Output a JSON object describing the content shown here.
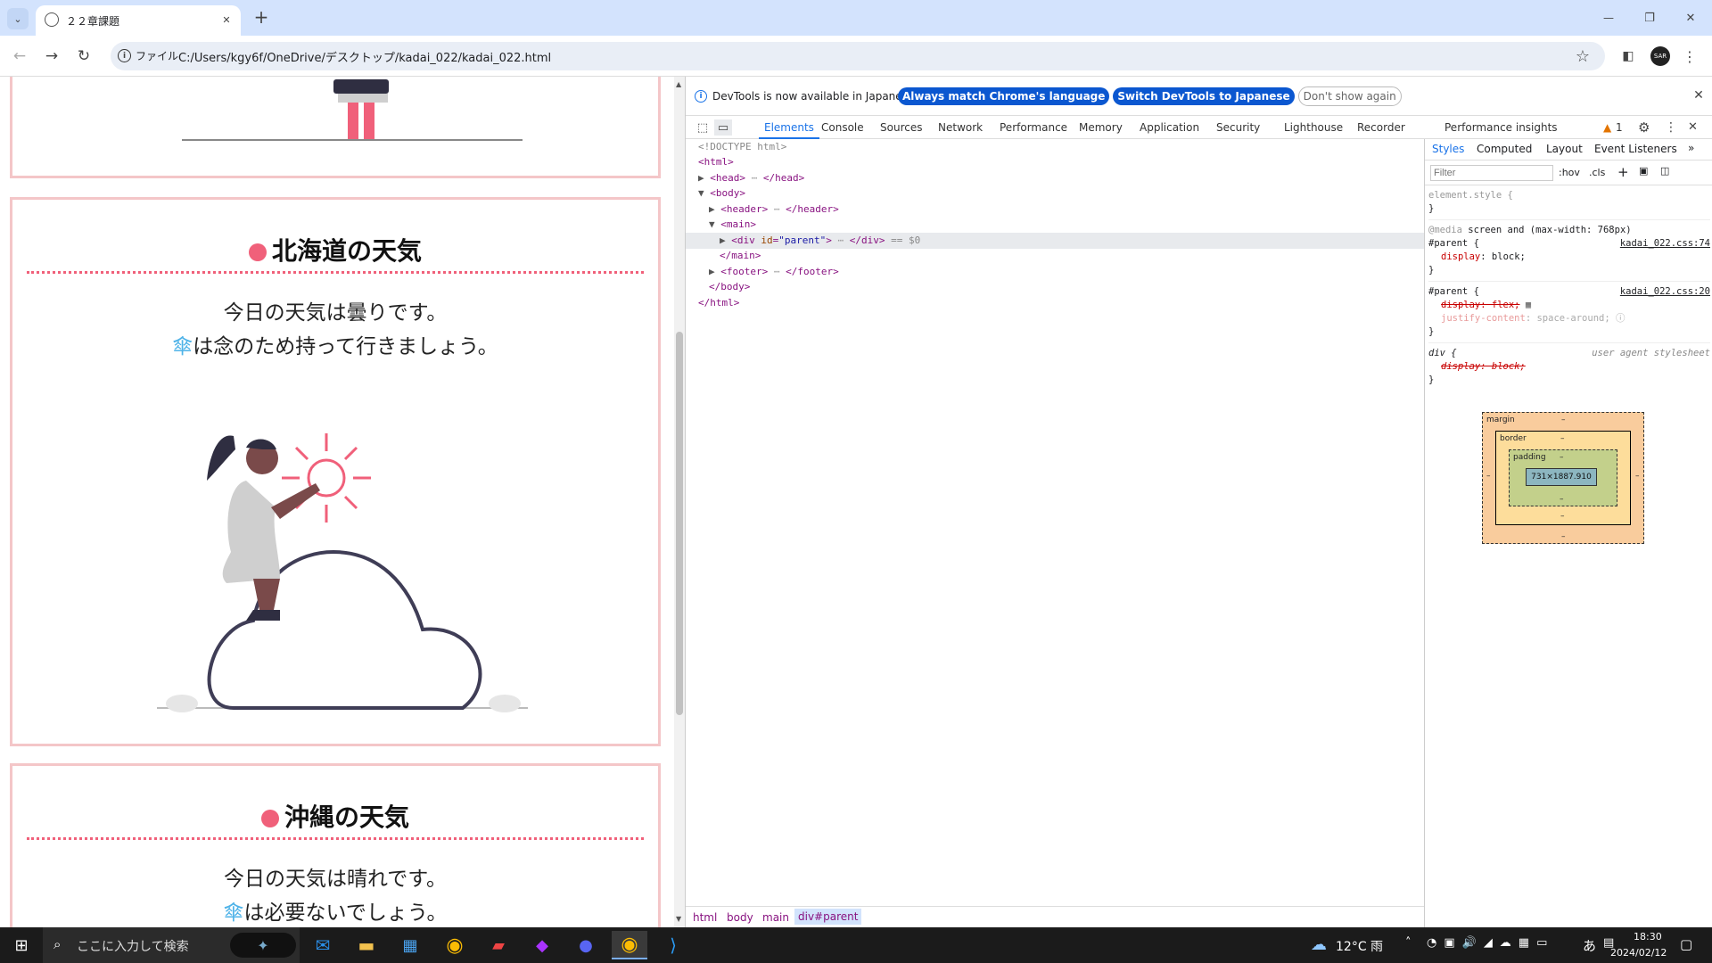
{
  "browser": {
    "tab_title": "２２章課題",
    "new_tab": "+",
    "file_chip": "ファイル",
    "url": "C:/Users/kgy6f/OneDrive/デスクトップ/kadai_022/kadai_022.html",
    "window_minimize": "—",
    "window_restore": "❐",
    "window_close": "✕"
  },
  "page": {
    "cards": [
      {
        "title": "北海道の天気",
        "line1": "今日の天気は曇りです。",
        "umbrella": "傘",
        "line2_rest": "は念のため持って行きましょう。"
      },
      {
        "title": "沖縄の天気",
        "line1": "今日の天気は晴れです。",
        "umbrella": "傘",
        "line2_rest": "は必要ないでしょう。"
      }
    ],
    "colors": {
      "accent": "#f0607a",
      "border": "#f4c6c8",
      "umbrella": "#4fb3e8"
    }
  },
  "devtools": {
    "info_text": "DevTools is now available in Japanese!",
    "btn_match": "Always match Chrome's language",
    "btn_switch": "Switch DevTools to Japanese",
    "btn_dont": "Don't show again",
    "tabs": [
      "Elements",
      "Console",
      "Sources",
      "Network",
      "Performance",
      "Memory",
      "Application",
      "Security",
      "Lighthouse",
      "Recorder",
      "Performance insights"
    ],
    "warn_count": "1",
    "dom": {
      "doctype": "<!DOCTYPE html>",
      "html_open": "<html>",
      "head": "<head>",
      "head_close": "</head>",
      "body_open": "<body>",
      "header": "<header>",
      "header_close": "</header>",
      "main_open": "<main>",
      "div_tag": "<div ",
      "div_attr": "id",
      "div_val": "\"parent\"",
      "div_gt": ">",
      "div_close": "</div>",
      "eq": "== $0",
      "main_close": "</main>",
      "footer": "<footer>",
      "footer_close": "</footer>",
      "body_close": "</body>",
      "html_close": "</html>"
    },
    "breadcrumbs": [
      "html",
      "body",
      "main",
      "div#parent"
    ],
    "styles_tabs": [
      "Styles",
      "Computed",
      "Layout",
      "Event Listeners"
    ],
    "filter_placeholder": "Filter",
    "hov": ":hov",
    "cls": ".cls",
    "rules": {
      "element_style": "element.style {",
      "close": "}",
      "media": "@media",
      "media_rest": " screen and (max-width: 768px)",
      "parent_sel": "#parent {",
      "src1": "kadai_022.css:74",
      "prop_display": "display",
      "val_block": "block;",
      "src2": "kadai_022.css:20",
      "prop_display_flex": "display: flex;",
      "prop_jc": "justify-content",
      "val_jc": "space-around;",
      "div_sel": "div {",
      "ua": "user agent stylesheet",
      "div_display_block": "display: block;"
    },
    "box_model": {
      "margin": "margin",
      "border": "border",
      "padding": "padding",
      "content": "731×1887.910",
      "dash": "–"
    }
  },
  "taskbar": {
    "search": "ここに入力して検索",
    "weather": "12°C 雨",
    "ime": "あ",
    "time": "18:30",
    "date": "2024/02/12"
  }
}
